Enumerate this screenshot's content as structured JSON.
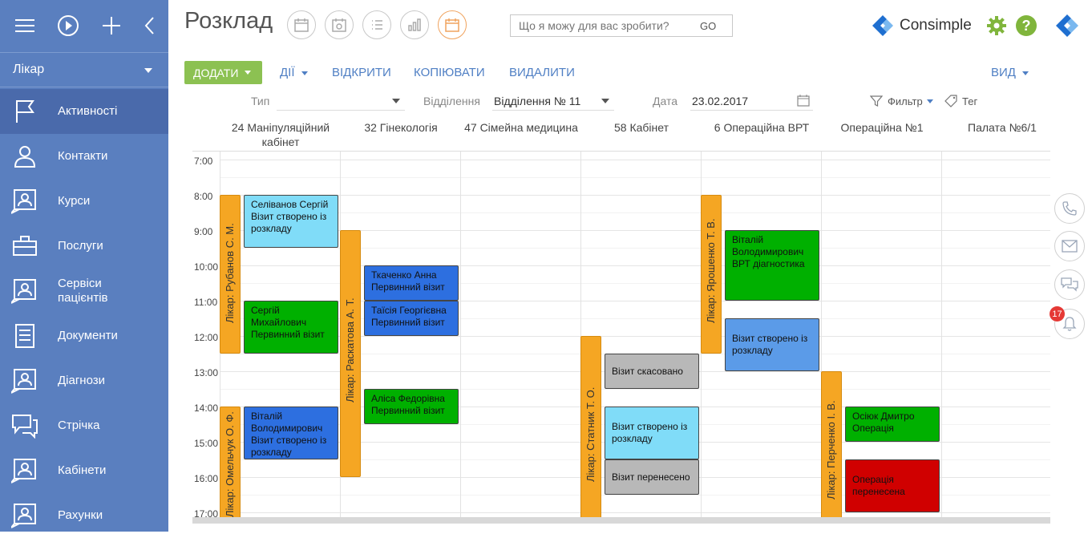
{
  "sidebar": {
    "role": "Лікар",
    "items": [
      {
        "label": "Активності",
        "icon": "flag-icon"
      },
      {
        "label": "Контакти",
        "icon": "person-icon"
      },
      {
        "label": "Курси",
        "icon": "person-card-icon"
      },
      {
        "label": "Послуги",
        "icon": "briefcase-icon"
      },
      {
        "label": "Сервіси пацієнтів",
        "icon": "person-card-icon"
      },
      {
        "label": "Документи",
        "icon": "document-icon"
      },
      {
        "label": "Діагнози",
        "icon": "person-card-icon"
      },
      {
        "label": "Стрічка",
        "icon": "chat-icon"
      },
      {
        "label": "Кабінети",
        "icon": "person-card-icon"
      },
      {
        "label": "Рахунки",
        "icon": "person-card-icon"
      }
    ]
  },
  "header": {
    "title": "Розклад",
    "search_placeholder": "Що я можу для вас зробити?",
    "go": "GO",
    "logo_text": "Consimple"
  },
  "actions": {
    "add": "ДОДАТИ",
    "actions": "ДІЇ",
    "open": "ВІДКРИТИ",
    "copy": "КОПІЮВАТИ",
    "delete": "ВИДАЛИТИ",
    "view": "ВИД"
  },
  "filters": {
    "type_label": "Тип",
    "type_value": "",
    "dept_label": "Відділення",
    "dept_value": "Відділення № 11",
    "date_label": "Дата",
    "date_value": "23.02.2017",
    "filter_label": "Фильтр",
    "tag_label": "Тег"
  },
  "columns": [
    "24 Маніпуляційний кабінет",
    "32 Гінекологія",
    "47 Сімейна медицина",
    "58 Кабінет",
    "6 Операційна ВРТ",
    "Операційна №1",
    "Палата №6/1"
  ],
  "times": [
    "7:00",
    "8:00",
    "9:00",
    "10:00",
    "11:00",
    "12:00",
    "13:00",
    "14:00",
    "15:00",
    "16:00",
    "17:00"
  ],
  "doctors": [
    {
      "label": "Лікар: Рубанов С. М.",
      "col": 0,
      "start": 8.0,
      "end": 12.5
    },
    {
      "label": "Лікар: Омельчук О. Ф.",
      "col": 0,
      "start": 14.0,
      "end": 17.5
    },
    {
      "label": "Лікар: Раскатова А. Т.",
      "col": 1,
      "start": 9.0,
      "end": 16.0
    },
    {
      "label": "Лікар: Статник Т. О.",
      "col": 3,
      "start": 12.0,
      "end": 17.5
    },
    {
      "label": "Лікар: Ярошенко Т. В.",
      "col": 4,
      "start": 8.0,
      "end": 12.5
    },
    {
      "label": "Лікар: Перченко І. В.",
      "col": 5,
      "start": 13.0,
      "end": 17.5
    }
  ],
  "events": [
    {
      "text": "Селіванов Сергій\nВізит створено із розкладу",
      "col": 0,
      "start": 8.0,
      "end": 9.5,
      "color": "#80dcf8"
    },
    {
      "text": "Сергій Михайлович\nПервинний візит",
      "col": 0,
      "start": 11.0,
      "end": 12.5,
      "color": "#00b000"
    },
    {
      "text": "Віталій Володимирович\nВізит створено із розкладу",
      "col": 0,
      "start": 14.0,
      "end": 15.5,
      "color": "#2d6fe0"
    },
    {
      "text": "Ткаченко Анна\nПервинний візит",
      "col": 1,
      "start": 10.0,
      "end": 11.0,
      "color": "#2d6fe0"
    },
    {
      "text": "Таїсія Георгієвна\nПервинний візит",
      "col": 1,
      "start": 11.0,
      "end": 12.0,
      "color": "#2d6fe0"
    },
    {
      "text": "Аліса Федорівна\nПервинний візит",
      "col": 1,
      "start": 13.5,
      "end": 14.5,
      "color": "#00b000"
    },
    {
      "text": "Візит скасовано",
      "col": 3,
      "start": 12.5,
      "end": 13.5,
      "color": "#b8b8b8"
    },
    {
      "text": "Візит створено із розкладу",
      "col": 3,
      "start": 14.0,
      "end": 15.5,
      "color": "#80dcf8"
    },
    {
      "text": "Візит перенесено",
      "col": 3,
      "start": 15.5,
      "end": 16.5,
      "color": "#b8b8b8"
    },
    {
      "text": "Віталій Володимирович\nВРТ діагностика",
      "col": 4,
      "start": 9.0,
      "end": 11.0,
      "color": "#00b000"
    },
    {
      "text": "Візит створено із розкладу",
      "col": 4,
      "start": 11.5,
      "end": 13.0,
      "color": "#5b9be8"
    },
    {
      "text": "Осіюк Дмитро\nОперація",
      "col": 5,
      "start": 14.0,
      "end": 15.0,
      "color": "#00b000"
    },
    {
      "text": "Операція перенесена",
      "col": 5,
      "start": 15.5,
      "end": 17.0,
      "color": "#d00000"
    }
  ],
  "notifications_count": "17"
}
